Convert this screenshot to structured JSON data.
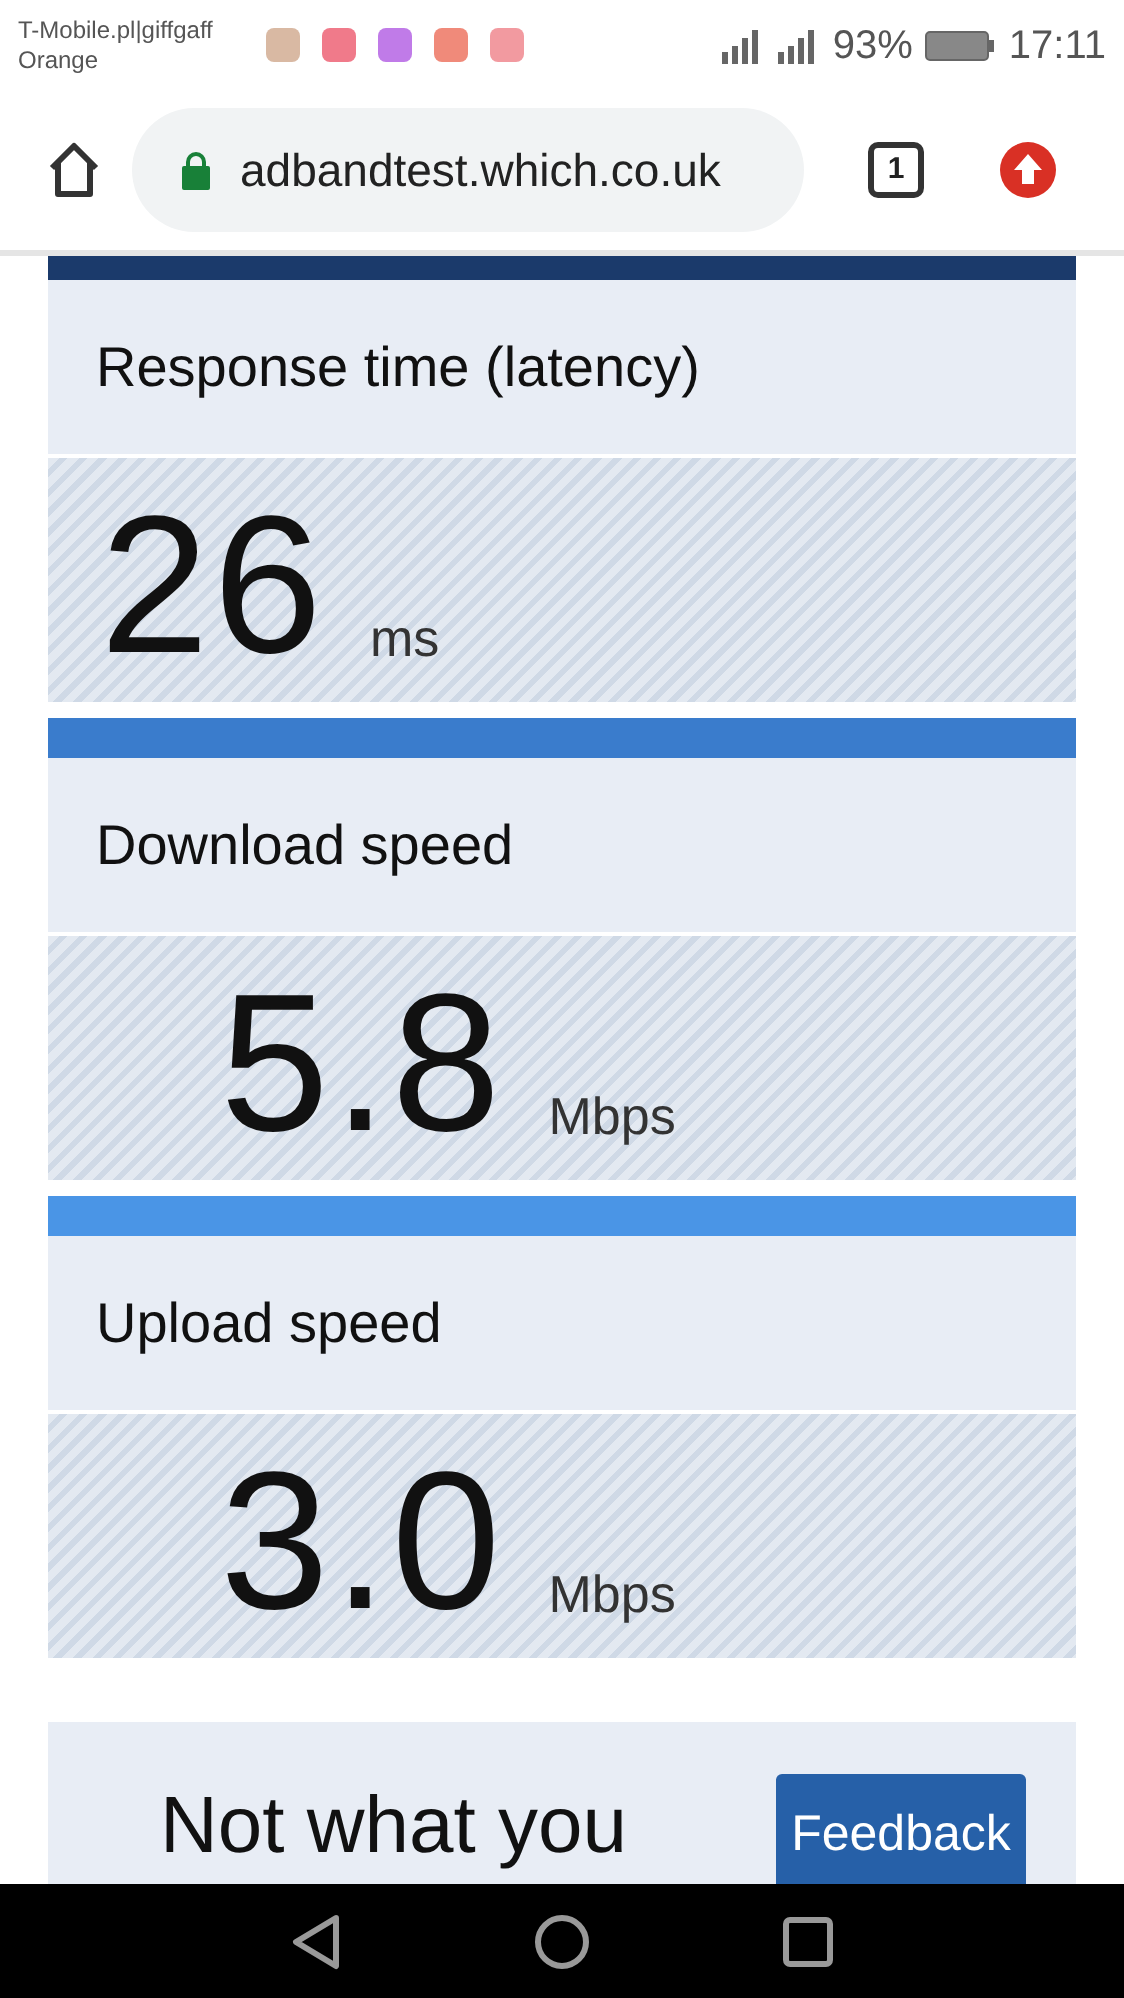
{
  "status_bar": {
    "carriers": [
      "T-Mobile.pl|giffgaff",
      "Orange"
    ],
    "battery": "93%",
    "time": "17:11"
  },
  "browser": {
    "url": "adbandtest.which.co.uk",
    "tab_count": "1"
  },
  "results": [
    {
      "title": "Response time (latency)",
      "value": "26",
      "unit": "ms",
      "color": "#1b3a6b"
    },
    {
      "title": "Download speed",
      "value": "5.8",
      "unit": "Mbps",
      "color": "#3a7ccc"
    },
    {
      "title": "Upload speed",
      "value": "3.0",
      "unit": "Mbps",
      "color": "#4a95e6"
    }
  ],
  "next_card": {
    "heading": "Not what you"
  },
  "feedback_button": {
    "label": "Feedback"
  }
}
